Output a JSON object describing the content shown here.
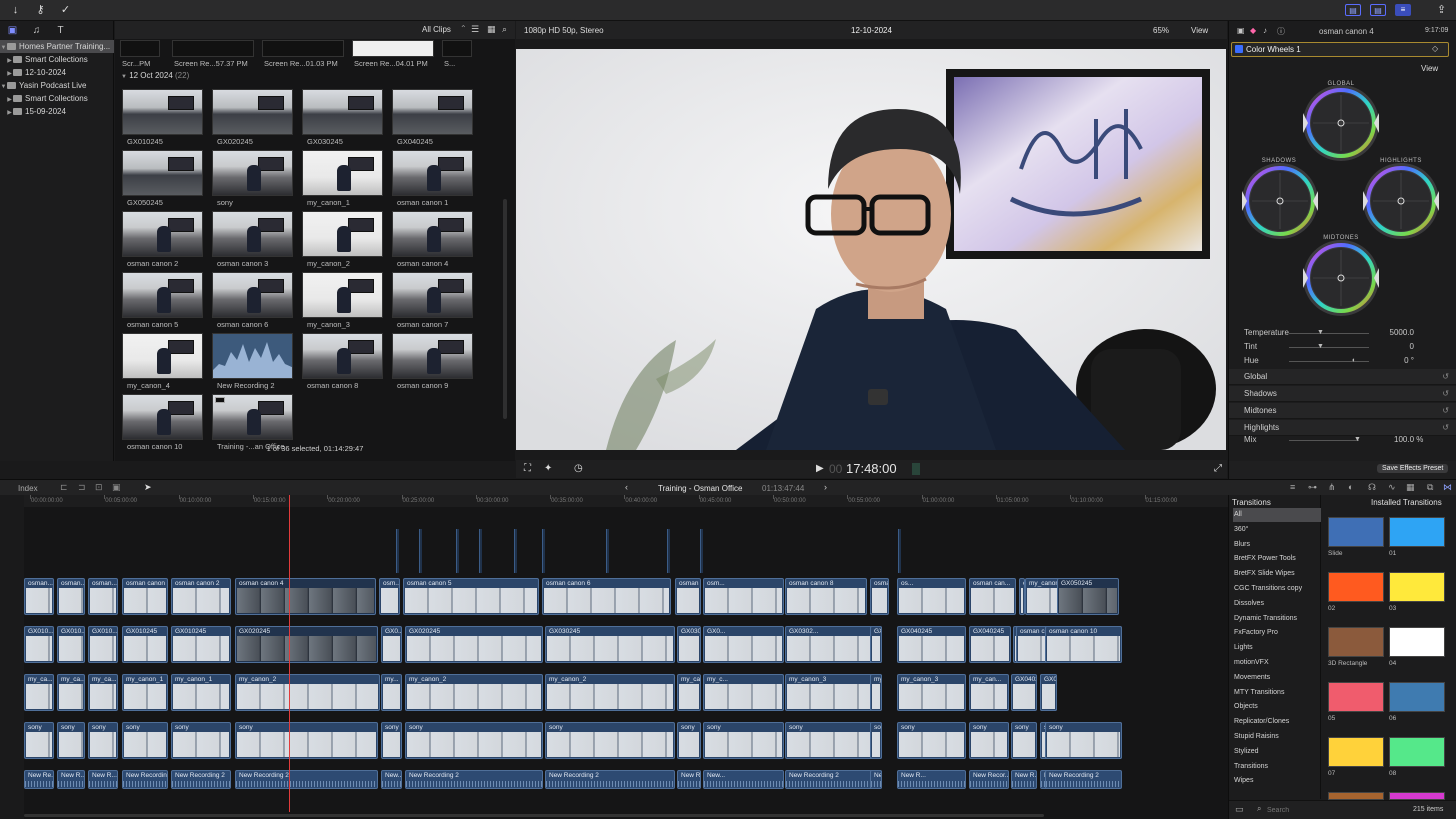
{
  "browser": {
    "filter_label": "All Clips",
    "group_header": "12 Oct 2024",
    "group_count": "(22)",
    "status": "1 of 36 selected, 01:14:29:47",
    "top_strip": [
      "Scr...PM",
      "Screen Re...57.37 PM",
      "Screen Re...01.03 PM",
      "Screen Re...04.01 PM",
      "S..."
    ],
    "clips": [
      "GX010245",
      "GX020245",
      "GX030245",
      "GX040245",
      "GX050245",
      "sony",
      "my_canon_1",
      "osman canon 1",
      "osman canon 2",
      "osman canon 3",
      "my_canon_2",
      "osman canon 4",
      "osman canon 5",
      "osman canon 6",
      "my_canon_3",
      "osman canon 7",
      "my_canon_4",
      "New Recording 2",
      "osman canon 8",
      "osman canon 9",
      "osman canon 10",
      "Training -...an Office"
    ]
  },
  "libraries": {
    "items": [
      {
        "label": "Homes Partner Training...",
        "indent": 0,
        "open": true
      },
      {
        "label": "Smart Collections",
        "indent": 1,
        "open": false
      },
      {
        "label": "12-10-2024",
        "indent": 1,
        "open": false
      },
      {
        "label": "Yasin Podcast Live",
        "indent": 0,
        "open": true
      },
      {
        "label": "Smart Collections",
        "indent": 1,
        "open": false
      },
      {
        "label": "15-09-2024",
        "indent": 1,
        "open": false
      }
    ]
  },
  "viewer": {
    "format": "1080p HD 50p, Stereo",
    "date": "12-10-2024",
    "zoom": "65%",
    "view_label": "View",
    "timecode": "17:48:00",
    "timecode_prefix": "00"
  },
  "inspector": {
    "clip_name": "osman canon 4",
    "duration": "9:17:09",
    "effect": "Color Wheels 1",
    "view_label": "View",
    "wheels": {
      "global": "GLOBAL",
      "shadows": "SHADOWS",
      "highlights": "HIGHLIGHTS",
      "midtones": "MIDTONES"
    },
    "params": [
      {
        "label": "Temperature",
        "value": "5000.0"
      },
      {
        "label": "Tint",
        "value": "0"
      },
      {
        "label": "Hue",
        "value": "0 °"
      }
    ],
    "sections": [
      "Global",
      "Shadows",
      "Midtones",
      "Highlights"
    ],
    "mix_label": "Mix",
    "mix_value": "100.0 %",
    "save_button": "Save Effects Preset"
  },
  "timeline": {
    "index_label": "Index",
    "project": "Training - Osman Office",
    "duration": "01:13:47:44",
    "ruler": [
      "00:00:00:00",
      "00:05:00:00",
      "00:10:00:00",
      "00:15:00:00",
      "00:20:00:00",
      "00:25:00:00",
      "00:30:00:00",
      "00:35:00:00",
      "00:40:00:00",
      "00:45:00:00",
      "00:50:00:00",
      "00:55:00:00",
      "01:00:00:00",
      "01:05:00:00",
      "01:10:00:00",
      "01:15:00:00"
    ],
    "lanes": {
      "lane1": [
        "osman...",
        "osman...",
        "osman...",
        "osman canon 1",
        "osman canon 2",
        "osman canon 4",
        "osm...",
        "osman canon 5",
        "osman canon 6",
        "osman canon 7",
        "osm...",
        "osman canon 8",
        "osman canon 9",
        "os...",
        "osman can...",
        "osm...",
        "my_canon_4",
        "",
        "GX050245"
      ],
      "lane2": [
        "GX010...",
        "GX010...",
        "GX010...",
        "GX010245",
        "GX010245",
        "GX020245",
        "GX0...",
        "GX020245",
        "GX030245",
        "GX030245",
        "GX0...",
        "GX0302...",
        "GX040245",
        "GX040245",
        "GX040245",
        "GX04...",
        "osman can...",
        "osman...",
        "osman canon 10"
      ],
      "lane3": [
        "my_ca...",
        "my_ca...",
        "my_ca...",
        "my_canon_1",
        "my_canon_1",
        "my_canon_2",
        "my...",
        "my_canon_2",
        "my_canon_2",
        "my_canon_3",
        "my_c...",
        "my_canon_3",
        "my_canon_3",
        "my_canon_3",
        "my_can...",
        "GX040245",
        "G...",
        "GX04..."
      ],
      "primary": [
        "sony",
        "sony",
        "sony",
        "sony",
        "sony",
        "sony",
        "sony",
        "sony",
        "sony",
        "sony",
        "sony",
        "sony",
        "sony",
        "sony",
        "sony",
        "sony",
        "sony",
        "sony",
        "sony"
      ],
      "audio": [
        "New Re...",
        "New R...",
        "New R...",
        "New Recording 2",
        "New Recording 2",
        "New Recording 2",
        "New...",
        "New Recording 2",
        "New Recording 2",
        "New Recording 2",
        "New...",
        "New Recording 2",
        "New Recording 2",
        "New R...",
        "New Recor...",
        "New R...",
        "New R...",
        "New Recording 2"
      ]
    }
  },
  "transitions": {
    "title": "Transitions",
    "installed": "Installed Transitions",
    "categories": [
      "All",
      "360°",
      "Blurs",
      "BretFX Power Tools",
      "BretFX Slide Wipes",
      "CGC Transitions copy",
      "Dissolves",
      "Dynamic Transitions",
      "FxFactory Pro",
      "Lights",
      "motionVFX",
      "Movements",
      "MTY Transitions",
      "Objects",
      "Replicator/Clones",
      "Stupid Raisins",
      "Stylized",
      "Transitions",
      "Wipes"
    ],
    "items": [
      {
        "name": "Slide",
        "color": "#3f6fb5"
      },
      {
        "name": "01",
        "color": "#2ea4f4"
      },
      {
        "name": "02",
        "color": "#ff5a1f"
      },
      {
        "name": "03",
        "color": "#ffe93b"
      },
      {
        "name": "3D Rectangle",
        "color": "#8b5a3c"
      },
      {
        "name": "04",
        "color": "#ffffff"
      },
      {
        "name": "05",
        "color": "#f05c6d"
      },
      {
        "name": "06",
        "color": "#3f7bb0"
      },
      {
        "name": "07",
        "color": "#ffd23a"
      },
      {
        "name": "08",
        "color": "#55e88a"
      }
    ],
    "search_placeholder": "Search",
    "count": "215 items"
  }
}
